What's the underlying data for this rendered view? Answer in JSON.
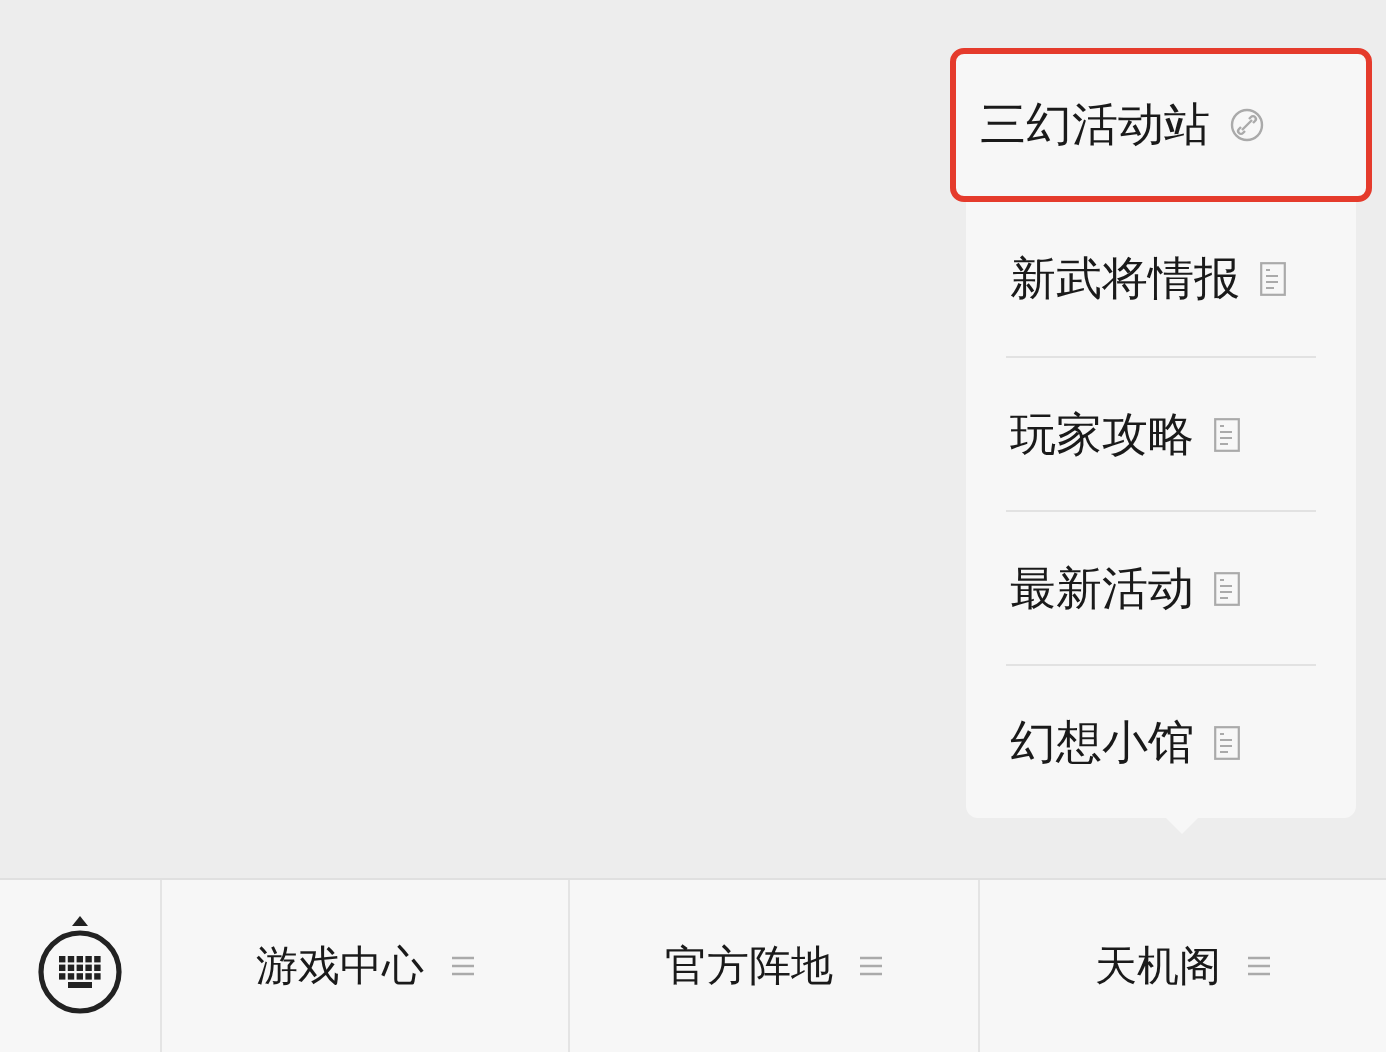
{
  "submenu": {
    "items": [
      {
        "label": "三幻活动站",
        "kind": "miniprogram",
        "highlighted": true
      },
      {
        "label": "新武将情报",
        "kind": "article",
        "highlighted": false
      },
      {
        "label": "玩家攻略",
        "kind": "article",
        "highlighted": false
      },
      {
        "label": "最新活动",
        "kind": "article",
        "highlighted": false
      },
      {
        "label": "幻想小馆",
        "kind": "article",
        "highlighted": false
      }
    ]
  },
  "menu_bar": {
    "items": [
      {
        "label": "游戏中心"
      },
      {
        "label": "官方阵地"
      },
      {
        "label": "天机阁"
      }
    ]
  }
}
